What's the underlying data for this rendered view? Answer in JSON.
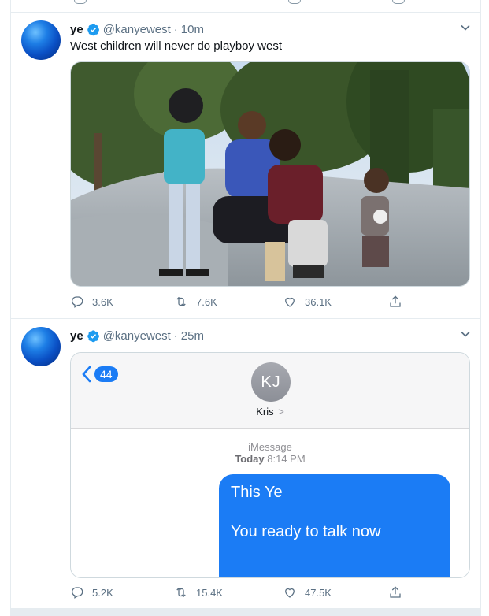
{
  "tweets": [
    {
      "name": "ye",
      "handle": "@kanyewest",
      "separator": "·",
      "time": "10m",
      "text": "West children will never do playboy  west",
      "media_alt": "photo of children at a skatepark",
      "stats": {
        "replies": "3.6K",
        "retweets": "7.6K",
        "likes": "36.1K"
      }
    },
    {
      "name": "ye",
      "handle": "@kanyewest",
      "separator": "·",
      "time": "25m",
      "imessage": {
        "back_count": "44",
        "contact_initials": "KJ",
        "contact_name": "Kris",
        "contact_arrow": ">",
        "service": "iMessage",
        "day": "Today",
        "clock": "8:14 PM",
        "bubble_line1": "This Ye",
        "bubble_line2": "You ready to talk now"
      },
      "stats": {
        "replies": "5.2K",
        "retweets": "15.4K",
        "likes": "47.5K"
      }
    }
  ],
  "colors": {
    "verified": "#1d9bf0",
    "imessage_blue": "#1b7cf5",
    "muted": "#5b7083"
  }
}
